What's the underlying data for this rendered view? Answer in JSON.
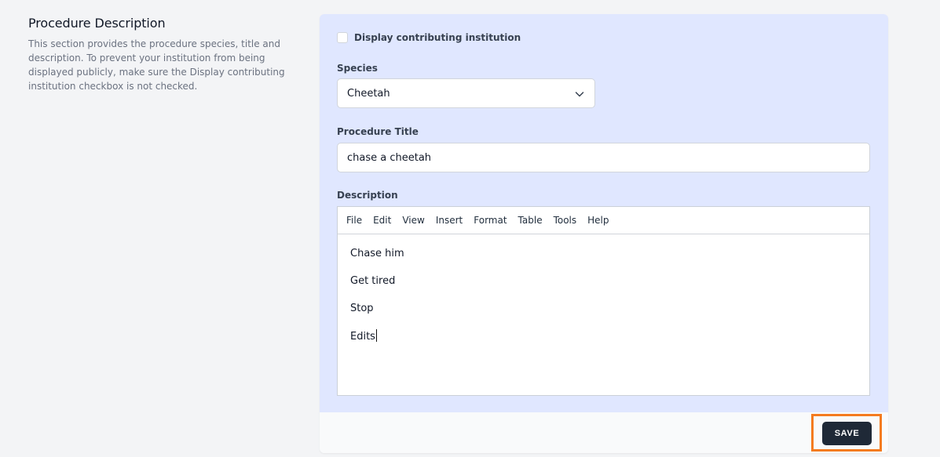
{
  "intro": {
    "title": "Procedure Description",
    "description": "This section provides the procedure species, title and description. To prevent your institution from being displayed publicly, make sure the Display contributing institution checkbox is not checked."
  },
  "form": {
    "display_institution_label": "Display contributing institution",
    "display_institution_checked": false,
    "species_label": "Species",
    "species_value": "Cheetah",
    "title_label": "Procedure Title",
    "title_value": "chase a cheetah",
    "description_label": "Description",
    "editor_menu": [
      "File",
      "Edit",
      "View",
      "Insert",
      "Format",
      "Table",
      "Tools",
      "Help"
    ],
    "editor_paragraphs": [
      "Chase him",
      "Get tired",
      "Stop",
      "Edits"
    ]
  },
  "footer": {
    "save_label": "SAVE"
  },
  "colors": {
    "card_body": "#e0e7ff",
    "save_button": "#1f2937",
    "highlight": "#f47b20"
  },
  "icons": {
    "species_dropdown": "chevron-down-icon"
  }
}
